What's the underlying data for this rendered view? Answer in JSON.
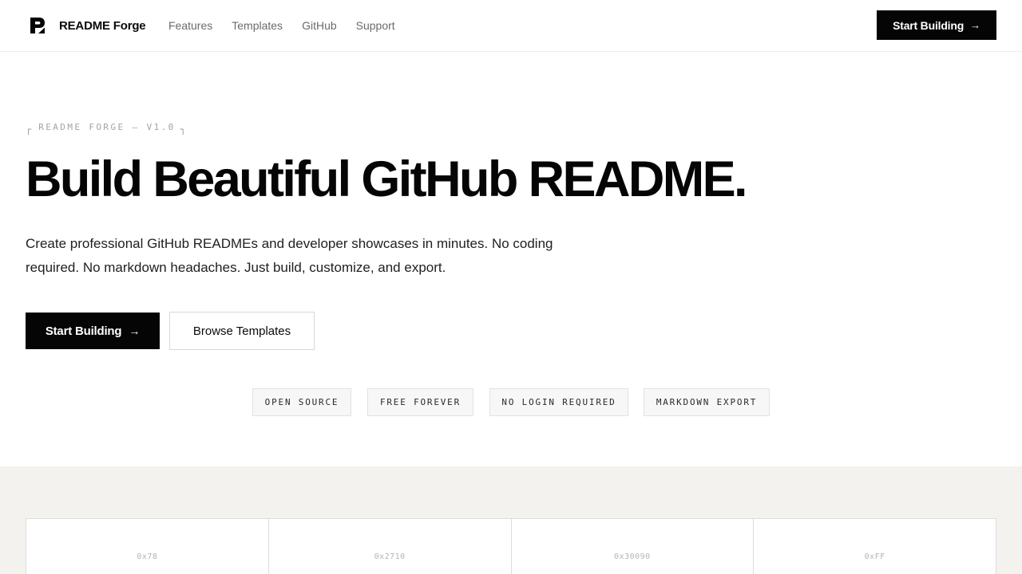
{
  "header": {
    "brand_name": "README Forge",
    "brand_icon": "forge-logo-icon",
    "nav": [
      "Features",
      "Templates",
      "GitHub",
      "Support"
    ],
    "cta_label": "Start Building",
    "cta_icon": "arrow-right-icon"
  },
  "hero": {
    "eyebrow": "README FORGE — V1.0",
    "title": "Build Beautiful GitHub README.",
    "subtitle": "Create professional GitHub READMEs and developer showcases in minutes. No coding required. No markdown headaches. Just build, customize, and export.",
    "primary_label": "Start Building",
    "secondary_label": "Browse Templates",
    "badges": [
      "OPEN SOURCE",
      "FREE FOREVER",
      "NO LOGIN REQUIRED",
      "MARKDOWN EXPORT"
    ]
  },
  "panel": {
    "codes": [
      "0x78",
      "0x2710",
      "0x30090",
      "0xFF"
    ]
  },
  "colors": {
    "primary": "#050505",
    "muted_text": "#6b6b6b",
    "lower_bg": "#f4f2ee"
  }
}
